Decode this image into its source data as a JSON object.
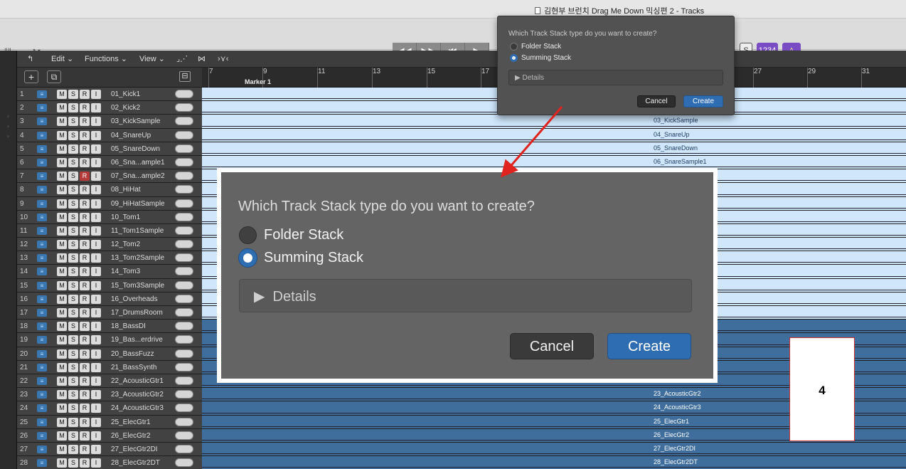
{
  "window": {
    "title": "김현부 브런치 Drag Me Down 믹싱편 2 - Tracks"
  },
  "toolbar": {
    "mixer_glyph": "⫲⫳",
    "scissors_glyph": "✂",
    "transport": [
      "rewind-icon",
      "fast-forward-icon",
      "go-to-start-icon",
      "play-icon"
    ],
    "transport_glyphs": [
      "◀◀",
      "▶▶",
      "⏮",
      "▶"
    ],
    "solo_label": "S",
    "lcd_label": "1234",
    "metronome_glyph": "♙"
  },
  "menubar": {
    "back_glyph": "↰",
    "edit": "Edit",
    "functions": "Functions",
    "view": "View",
    "chev": "⌄",
    "tool1": "⌟⋰",
    "tool2": "⋈",
    "tool3": "›⋎‹"
  },
  "track_header": {
    "add": "+",
    "dup": "⧉",
    "catch": "⊟"
  },
  "ruler": {
    "bars": [
      "7",
      "9",
      "11",
      "13",
      "15",
      "17",
      "27",
      "29",
      "31"
    ],
    "marker": "Marker 1"
  },
  "tracks": [
    {
      "num": "1",
      "name": "01_Kick1",
      "region": ""
    },
    {
      "num": "2",
      "name": "02_Kick2",
      "region": ""
    },
    {
      "num": "3",
      "name": "03_KickSample",
      "region": "03_KickSample"
    },
    {
      "num": "4",
      "name": "04_SnareUp",
      "region": "04_SnareUp"
    },
    {
      "num": "5",
      "name": "05_SnareDown",
      "region": "05_SnareDown"
    },
    {
      "num": "6",
      "name": "06_Sna...ample1",
      "region": "06_SnareSample1"
    },
    {
      "num": "7",
      "name": "07_Sna...ample2",
      "region": ""
    },
    {
      "num": "8",
      "name": "08_HiHat",
      "region": ""
    },
    {
      "num": "9",
      "name": "09_HiHatSample",
      "region": ""
    },
    {
      "num": "10",
      "name": "10_Tom1",
      "region": ""
    },
    {
      "num": "11",
      "name": "11_Tom1Sample",
      "region": ""
    },
    {
      "num": "12",
      "name": "12_Tom2",
      "region": ""
    },
    {
      "num": "13",
      "name": "13_Tom2Sample",
      "region": ""
    },
    {
      "num": "14",
      "name": "14_Tom3",
      "region": ""
    },
    {
      "num": "15",
      "name": "15_Tom3Sample",
      "region": ""
    },
    {
      "num": "16",
      "name": "16_Overheads",
      "region": ""
    },
    {
      "num": "17",
      "name": "17_DrumsRoom",
      "region": ""
    },
    {
      "num": "18",
      "name": "18_BassDI",
      "region": ""
    },
    {
      "num": "19",
      "name": "19_Bas...erdrive",
      "region": ""
    },
    {
      "num": "20",
      "name": "20_BassFuzz",
      "region": ""
    },
    {
      "num": "21",
      "name": "21_BassSynth",
      "region": ""
    },
    {
      "num": "22",
      "name": "22_AcousticGtr1",
      "region": ""
    },
    {
      "num": "23",
      "name": "23_AcousticGtr2",
      "region": "23_AcousticGtr2"
    },
    {
      "num": "24",
      "name": "24_AcousticGtr3",
      "region": "24_AcousticGtr3"
    },
    {
      "num": "25",
      "name": "25_ElecGtr1",
      "region": "25_ElecGtr1"
    },
    {
      "num": "26",
      "name": "26_ElecGtr2",
      "region": "26_ElecGtr2"
    },
    {
      "num": "27",
      "name": "27_ElecGtr2DI",
      "region": "27_ElecGtr2DI"
    },
    {
      "num": "28",
      "name": "28_ElecGtr2DT",
      "region": "28_ElecGtr2DT"
    }
  ],
  "track_buttons": {
    "m": "M",
    "s": "S",
    "r": "R",
    "i": "I",
    "inst_glyph": "≡"
  },
  "dialog": {
    "question": "Which Track Stack type do you want to create?",
    "option_folder": "Folder Stack",
    "option_summing": "Summing Stack",
    "selected": "Summing Stack",
    "details": "Details",
    "details_glyph": "▶",
    "cancel": "Cancel",
    "create": "Create"
  },
  "callout": {
    "label": "4"
  },
  "colors": {
    "accent": "#2f6db3",
    "region_light": "#cfe6fb",
    "region_dark": "#3f6e9c",
    "annotation_arrow": "#e0231f",
    "lcd_purple": "#7a4cc4"
  }
}
